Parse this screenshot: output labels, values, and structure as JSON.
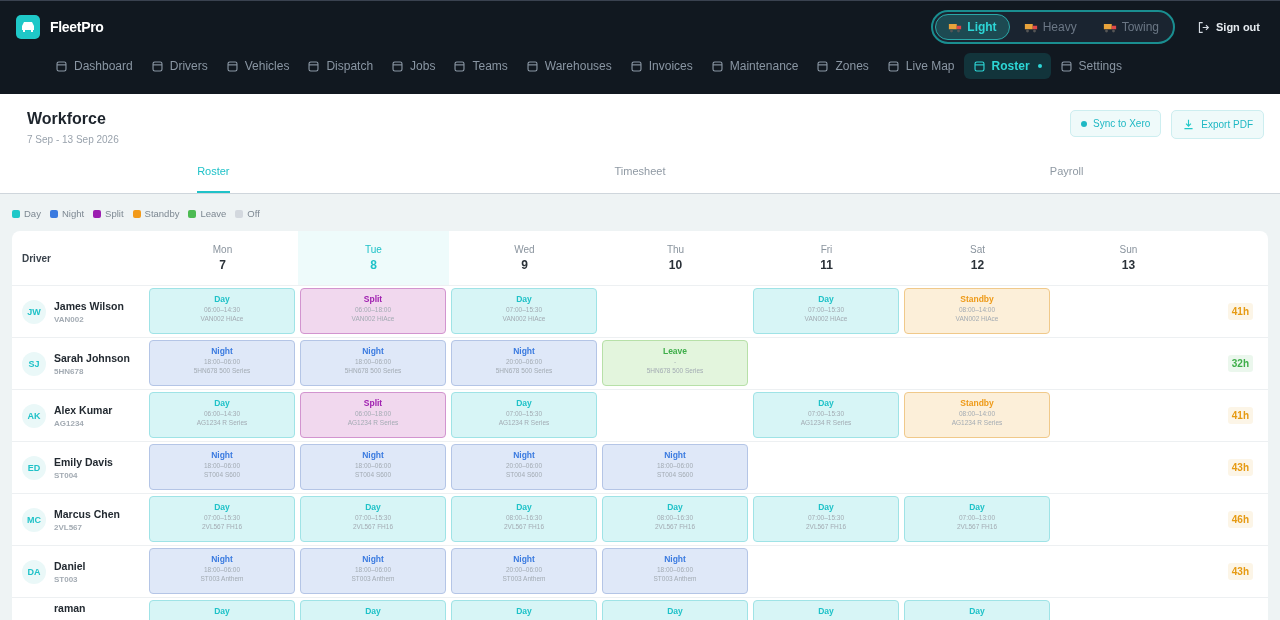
{
  "brand": {
    "name": "FleetPro"
  },
  "modes": [
    {
      "label": "Light",
      "selected": true
    },
    {
      "label": "Heavy",
      "selected": false
    },
    {
      "label": "Towing",
      "selected": false
    }
  ],
  "sign_out": "Sign out",
  "nav": [
    {
      "label": "Dashboard",
      "selected": false
    },
    {
      "label": "Drivers",
      "selected": false
    },
    {
      "label": "Vehicles",
      "selected": false
    },
    {
      "label": "Dispatch",
      "selected": false
    },
    {
      "label": "Jobs",
      "selected": false
    },
    {
      "label": "Teams",
      "selected": false
    },
    {
      "label": "Warehouses",
      "selected": false
    },
    {
      "label": "Invoices",
      "selected": false
    },
    {
      "label": "Maintenance",
      "selected": false
    },
    {
      "label": "Zones",
      "selected": false
    },
    {
      "label": "Live Map",
      "selected": false
    },
    {
      "label": "Roster",
      "selected": true
    },
    {
      "label": "Settings",
      "selected": false
    }
  ],
  "page": {
    "title": "Workforce",
    "range": "7 Sep - 13 Sep 2026",
    "actions": [
      "Sync to Xero",
      "Export PDF"
    ]
  },
  "tabs": [
    {
      "label": "Roster",
      "selected": true
    },
    {
      "label": "Timesheet",
      "selected": false
    },
    {
      "label": "Payroll",
      "selected": false
    }
  ],
  "legend": [
    {
      "label": "Day",
      "color": "#1fc8c8"
    },
    {
      "label": "Night",
      "color": "#3b7be0"
    },
    {
      "label": "Split",
      "color": "#9b1fb0"
    },
    {
      "label": "Standby",
      "color": "#f29a1a"
    },
    {
      "label": "Leave",
      "color": "#4cbb52"
    },
    {
      "label": "Off",
      "color": "#d3d8de"
    }
  ],
  "table": {
    "driver_heading": "Driver",
    "days": [
      {
        "name": "Mon",
        "date": "7",
        "today": false
      },
      {
        "name": "Tue",
        "date": "8",
        "today": true
      },
      {
        "name": "Wed",
        "date": "9",
        "today": false
      },
      {
        "name": "Thu",
        "date": "10",
        "today": false
      },
      {
        "name": "Fri",
        "date": "11",
        "today": false
      },
      {
        "name": "Sat",
        "date": "12",
        "today": false
      },
      {
        "name": "Sun",
        "date": "13",
        "today": false
      }
    ],
    "rows": [
      {
        "initials": "JW",
        "name": "James Wilson",
        "vehicle": "VAN002",
        "total": {
          "text": "41h",
          "color": "#e69a12"
        },
        "shifts": [
          {
            "kind": "day",
            "label": "Day",
            "time": "06:00–14:30",
            "vehicle": "VAN002 HiAce"
          },
          {
            "kind": "split",
            "label": "Split",
            "time": "06:00–18:00",
            "vehicle": "VAN002 HiAce"
          },
          {
            "kind": "day",
            "label": "Day",
            "time": "07:00–15:30",
            "vehicle": "VAN002 HiAce"
          },
          {
            "kind": "none"
          },
          {
            "kind": "day",
            "label": "Day",
            "time": "07:00–15:30",
            "vehicle": "VAN002 HiAce"
          },
          {
            "kind": "standby",
            "label": "Standby",
            "time": "08:00–14:00",
            "vehicle": "VAN002 HiAce"
          },
          {
            "kind": "none"
          }
        ]
      },
      {
        "initials": "SJ",
        "name": "Sarah Johnson",
        "vehicle": "5HN678",
        "total": {
          "text": "32h",
          "color": "#3fae4a"
        },
        "shifts": [
          {
            "kind": "night",
            "label": "Night",
            "time": "18:00–06:00",
            "vehicle": "5HN678 500 Series"
          },
          {
            "kind": "night",
            "label": "Night",
            "time": "18:00–06:00",
            "vehicle": "5HN678 500 Series"
          },
          {
            "kind": "night",
            "label": "Night",
            "time": "20:00–06:00",
            "vehicle": "5HN678 500 Series"
          },
          {
            "kind": "leave",
            "label": "Leave",
            "time": "-",
            "vehicle": "5HN678 500 Series"
          },
          {
            "kind": "none"
          },
          {
            "kind": "none"
          },
          {
            "kind": "none"
          }
        ]
      },
      {
        "initials": "AK",
        "name": "Alex Kumar",
        "vehicle": "AG1234",
        "total": {
          "text": "41h",
          "color": "#e69a12"
        },
        "shifts": [
          {
            "kind": "day",
            "label": "Day",
            "time": "06:00–14:30",
            "vehicle": "AG1234 R Series"
          },
          {
            "kind": "split",
            "label": "Split",
            "time": "06:00–18:00",
            "vehicle": "AG1234 R Series"
          },
          {
            "kind": "day",
            "label": "Day",
            "time": "07:00–15:30",
            "vehicle": "AG1234 R Series"
          },
          {
            "kind": "none"
          },
          {
            "kind": "day",
            "label": "Day",
            "time": "07:00–15:30",
            "vehicle": "AG1234 R Series"
          },
          {
            "kind": "standby",
            "label": "Standby",
            "time": "08:00–14:00",
            "vehicle": "AG1234 R Series"
          },
          {
            "kind": "none"
          }
        ]
      },
      {
        "initials": "ED",
        "name": "Emily Davis",
        "vehicle": "ST004",
        "total": {
          "text": "43h",
          "color": "#e69a12"
        },
        "shifts": [
          {
            "kind": "night",
            "label": "Night",
            "time": "18:00–06:00",
            "vehicle": "ST004 S600"
          },
          {
            "kind": "night",
            "label": "Night",
            "time": "18:00–06:00",
            "vehicle": "ST004 S600"
          },
          {
            "kind": "night",
            "label": "Night",
            "time": "20:00–06:00",
            "vehicle": "ST004 S600"
          },
          {
            "kind": "night",
            "label": "Night",
            "time": "18:00–06:00",
            "vehicle": "ST004 S600"
          },
          {
            "kind": "none"
          },
          {
            "kind": "none"
          },
          {
            "kind": "none"
          }
        ]
      },
      {
        "initials": "MC",
        "name": "Marcus Chen",
        "vehicle": "2VL567",
        "total": {
          "text": "46h",
          "color": "#e69a12"
        },
        "shifts": [
          {
            "kind": "day",
            "label": "Day",
            "time": "07:00–15:30",
            "vehicle": "2VL567 FH16"
          },
          {
            "kind": "day",
            "label": "Day",
            "time": "07:00–15:30",
            "vehicle": "2VL567 FH16"
          },
          {
            "kind": "day",
            "label": "Day",
            "time": "08:00–16:30",
            "vehicle": "2VL567 FH16"
          },
          {
            "kind": "day",
            "label": "Day",
            "time": "08:00–16:30",
            "vehicle": "2VL567 FH16"
          },
          {
            "kind": "day",
            "label": "Day",
            "time": "07:00–15:30",
            "vehicle": "2VL567 FH16"
          },
          {
            "kind": "day",
            "label": "Day",
            "time": "07:00–13:00",
            "vehicle": "2VL567 FH16"
          },
          {
            "kind": "none"
          }
        ]
      },
      {
        "initials": "DA",
        "name": "Daniel",
        "vehicle": "ST003",
        "total": {
          "text": "43h",
          "color": "#e69a12"
        },
        "shifts": [
          {
            "kind": "night",
            "label": "Night",
            "time": "18:00–06:00",
            "vehicle": "ST003 Anthem"
          },
          {
            "kind": "night",
            "label": "Night",
            "time": "18:00–06:00",
            "vehicle": "ST003 Anthem"
          },
          {
            "kind": "night",
            "label": "Night",
            "time": "20:00–06:00",
            "vehicle": "ST003 Anthem"
          },
          {
            "kind": "night",
            "label": "Night",
            "time": "18:00–06:00",
            "vehicle": "ST003 Anthem"
          },
          {
            "kind": "none"
          },
          {
            "kind": "none"
          },
          {
            "kind": "none"
          }
        ]
      },
      {
        "name": "raman",
        "shifts": [
          {
            "kind": "day",
            "label": "Day"
          },
          {
            "kind": "day",
            "label": "Day"
          },
          {
            "kind": "day",
            "label": "Day"
          },
          {
            "kind": "day",
            "label": "Day"
          },
          {
            "kind": "day",
            "label": "Day"
          },
          {
            "kind": "day",
            "label": "Day"
          },
          {
            "kind": "none"
          }
        ]
      }
    ]
  }
}
